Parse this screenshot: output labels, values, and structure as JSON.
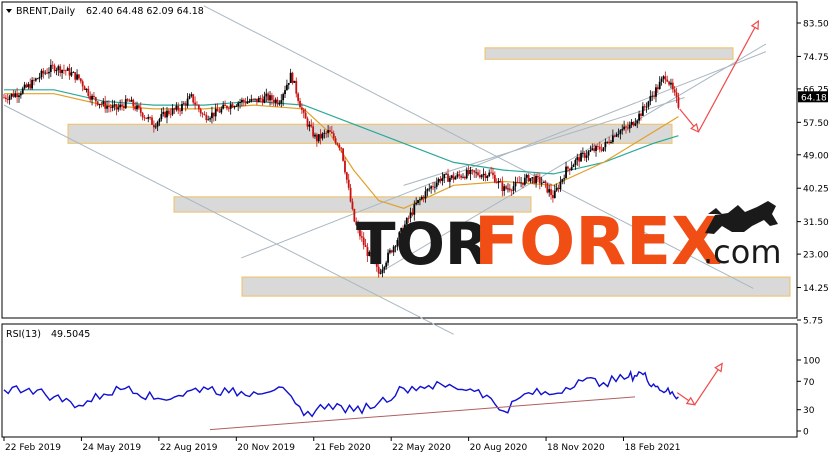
{
  "chart_data": [
    {
      "type": "candlestick",
      "symbol": "BRENT,Daily",
      "ohlc_label": "62.40 64.48 62.09 64.18",
      "last_price": "64.18",
      "ylim": [
        5.75,
        88
      ],
      "y_ticks": [
        "83.50",
        "74.75",
        "66.25",
        "57.50",
        "49.00",
        "40.25",
        "31.50",
        "23.00",
        "14.25",
        "5.75"
      ],
      "y_tick_values": [
        83.5,
        74.75,
        66.25,
        57.5,
        49.0,
        40.25,
        31.5,
        23.0,
        14.25,
        5.75
      ],
      "price_path": [
        [
          0,
          64
        ],
        [
          10,
          65
        ],
        [
          20,
          67
        ],
        [
          30,
          70
        ],
        [
          40,
          72
        ],
        [
          50,
          71
        ],
        [
          60,
          69
        ],
        [
          70,
          64
        ],
        [
          80,
          62
        ],
        [
          90,
          61
        ],
        [
          100,
          63
        ],
        [
          110,
          60
        ],
        [
          120,
          57
        ],
        [
          130,
          60
        ],
        [
          140,
          61
        ],
        [
          150,
          64
        ],
        [
          160,
          59
        ],
        [
          170,
          60
        ],
        [
          180,
          62
        ],
        [
          190,
          63
        ],
        [
          200,
          63
        ],
        [
          210,
          64
        ],
        [
          220,
          63
        ],
        [
          230,
          70
        ],
        [
          240,
          59
        ],
        [
          250,
          53
        ],
        [
          260,
          55
        ],
        [
          270,
          51
        ],
        [
          280,
          32
        ],
        [
          290,
          24
        ],
        [
          300,
          18
        ],
        [
          310,
          24
        ],
        [
          320,
          30
        ],
        [
          330,
          36
        ],
        [
          340,
          40
        ],
        [
          350,
          43
        ],
        [
          360,
          43
        ],
        [
          370,
          44
        ],
        [
          380,
          44
        ],
        [
          390,
          44
        ],
        [
          400,
          40
        ],
        [
          410,
          41
        ],
        [
          420,
          43
        ],
        [
          430,
          42
        ],
        [
          440,
          38
        ],
        [
          450,
          45
        ],
        [
          460,
          48
        ],
        [
          470,
          50
        ],
        [
          480,
          51
        ],
        [
          490,
          55
        ],
        [
          500,
          56
        ],
        [
          510,
          60
        ],
        [
          520,
          65
        ],
        [
          530,
          70
        ],
        [
          540,
          62
        ]
      ],
      "ma_slow": [
        [
          0,
          66
        ],
        [
          40,
          66
        ],
        [
          80,
          63
        ],
        [
          120,
          62
        ],
        [
          160,
          62
        ],
        [
          200,
          63
        ],
        [
          240,
          62
        ],
        [
          280,
          57
        ],
        [
          320,
          52
        ],
        [
          360,
          47
        ],
        [
          400,
          45
        ],
        [
          440,
          44
        ],
        [
          480,
          47
        ],
        [
          520,
          52
        ],
        [
          540,
          54
        ]
      ],
      "ma_fast": [
        [
          0,
          65
        ],
        [
          40,
          65
        ],
        [
          80,
          62
        ],
        [
          120,
          61
        ],
        [
          160,
          61
        ],
        [
          200,
          62
        ],
        [
          240,
          61
        ],
        [
          260,
          55
        ],
        [
          280,
          45
        ],
        [
          300,
          37
        ],
        [
          320,
          35
        ],
        [
          360,
          41
        ],
        [
          400,
          42
        ],
        [
          440,
          41
        ],
        [
          480,
          47
        ],
        [
          520,
          55
        ],
        [
          540,
          59
        ]
      ],
      "support_resistance_zones": [
        {
          "from": 74.0,
          "to": 77.0
        },
        {
          "from": 52.0,
          "to": 57.0
        },
        {
          "from": 34.0,
          "to": 38.0
        },
        {
          "from": 12.0,
          "to": 17.0
        }
      ],
      "forecast_arrows": [
        {
          "from": [
            541,
            61
          ],
          "to": [
            556,
            55
          ]
        },
        {
          "from": [
            556,
            55
          ],
          "to": [
            604,
            84
          ]
        }
      ],
      "x_tick_labels": [
        "22 Feb 2019",
        "24 May 2019",
        "22 Aug 2019",
        "20 Nov 2019",
        "21 Feb 2020",
        "22 May 2020",
        "20 Aug 2020",
        "18 Nov 2020",
        "18 Feb 2021"
      ],
      "x_tick_index": [
        0,
        62,
        124,
        186,
        248,
        310,
        372,
        434,
        496
      ],
      "colors": {
        "up": "#000000",
        "down": "#c81010",
        "ma_slow": "#2aa89a",
        "ma_fast": "#e2a028",
        "zone_fill": "#d9d9d9",
        "zone_border": "#f0c060",
        "channel": "#a9b7c2",
        "arrow": "#f24a4a",
        "rsi_line": "#1010d0",
        "trend": "#b06060",
        "last_price_bg": "#000000",
        "last_price_fg": "#ffffff"
      }
    },
    {
      "type": "line",
      "indicator": "RSI(13)",
      "value_label": "49.5045",
      "ylim": [
        0,
        100
      ],
      "y_ticks": [
        "100",
        "70",
        "30",
        "0"
      ],
      "y_tick_values": [
        100,
        70,
        30,
        0
      ],
      "values": [
        [
          0,
          58
        ],
        [
          20,
          60
        ],
        [
          40,
          48
        ],
        [
          60,
          36
        ],
        [
          80,
          52
        ],
        [
          100,
          63
        ],
        [
          120,
          45
        ],
        [
          140,
          50
        ],
        [
          160,
          62
        ],
        [
          180,
          54
        ],
        [
          200,
          55
        ],
        [
          220,
          62
        ],
        [
          240,
          22
        ],
        [
          260,
          38
        ],
        [
          280,
          28
        ],
        [
          300,
          40
        ],
        [
          320,
          60
        ],
        [
          340,
          64
        ],
        [
          360,
          62
        ],
        [
          380,
          58
        ],
        [
          400,
          28
        ],
        [
          420,
          54
        ],
        [
          440,
          52
        ],
        [
          460,
          72
        ],
        [
          480,
          68
        ],
        [
          500,
          76
        ],
        [
          510,
          82
        ],
        [
          520,
          66
        ],
        [
          530,
          56
        ],
        [
          540,
          48
        ]
      ],
      "trendline": [
        [
          210,
          2
        ],
        [
          635,
          48
        ]
      ],
      "forecast_arrows": [
        {
          "from": [
            539,
            54
          ],
          "to": [
            553,
            37
          ]
        },
        {
          "from": [
            553,
            37
          ],
          "to": [
            575,
            95
          ]
        }
      ]
    }
  ],
  "watermark": {
    "part1": "TOR",
    "part2": "FOREX",
    "part3": ".com"
  }
}
